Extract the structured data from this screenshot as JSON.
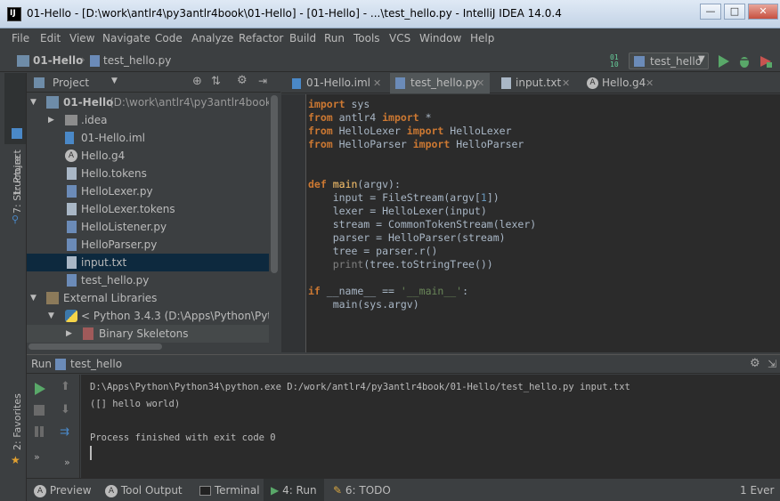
{
  "window": {
    "title": "01-Hello - [D:\\work\\antlr4\\py3antlr4book\\01-Hello] - [01-Hello] - ...\\test_hello.py - IntelliJ IDEA 14.0.4"
  },
  "menu": [
    "File",
    "Edit",
    "View",
    "Navigate",
    "Code",
    "Analyze",
    "Refactor",
    "Build",
    "Run",
    "Tools",
    "VCS",
    "Window",
    "Help"
  ],
  "breadcrumb": {
    "project": "01-Hello",
    "file": "test_hello.py"
  },
  "run_config": {
    "label": "test_hello"
  },
  "project_panel": {
    "title": "Project"
  },
  "tree": [
    {
      "label": "01-Hello",
      "path": "(D:\\work\\antlr4\\py3antlr4book\\01"
    },
    {
      "label": ".idea"
    },
    {
      "label": "01-Hello.iml"
    },
    {
      "label": "Hello.g4"
    },
    {
      "label": "Hello.tokens"
    },
    {
      "label": "HelloLexer.py"
    },
    {
      "label": "HelloLexer.tokens"
    },
    {
      "label": "HelloListener.py"
    },
    {
      "label": "HelloParser.py"
    },
    {
      "label": "input.txt"
    },
    {
      "label": "test_hello.py"
    },
    {
      "label": "External Libraries"
    },
    {
      "label": "< Python 3.4.3 (D:\\Apps\\Python\\Pythor"
    },
    {
      "label": "Binary Skeletons"
    }
  ],
  "tabs": [
    {
      "label": "01-Hello.iml"
    },
    {
      "label": "test_hello.py"
    },
    {
      "label": "input.txt"
    },
    {
      "label": "Hello.g4"
    }
  ],
  "side_tabs": {
    "project": "1: Project",
    "structure": "7: Structure",
    "favorites": "2: Favorites"
  },
  "run_panel": {
    "title": "Run",
    "config": "test_hello"
  },
  "console": [
    "D:\\Apps\\Python\\Python34\\python.exe D:/work/antlr4/py3antlr4book/01-Hello/test_hello.py input.txt",
    "([] hello world)",
    "",
    "Process finished with exit code 0"
  ],
  "status": {
    "preview": "Preview",
    "tool_output": "Tool Output",
    "terminal": "Terminal",
    "run": "4: Run",
    "todo": "6: TODO",
    "event": "1 Ever"
  }
}
